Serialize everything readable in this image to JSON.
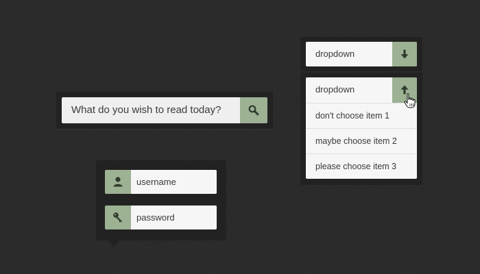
{
  "search": {
    "placeholder": "What do you wish to read today?",
    "button_icon": "search-icon"
  },
  "login": {
    "username_placeholder": "username",
    "password_placeholder": "password",
    "user_icon": "user-icon",
    "password_icon": "key-icon"
  },
  "dropdown_closed": {
    "label": "dropdown",
    "arrow_icon": "arrow-down-icon"
  },
  "dropdown_open": {
    "label": "dropdown",
    "arrow_icon": "arrow-up-icon",
    "items": [
      "don't choose item 1",
      "maybe choose item 2",
      "please choose item 3"
    ]
  },
  "colors": {
    "background": "#2b2b2b",
    "panel": "#222222",
    "accent": "#9db193",
    "field": "#f6f6f6",
    "text": "#3a3a3a"
  }
}
